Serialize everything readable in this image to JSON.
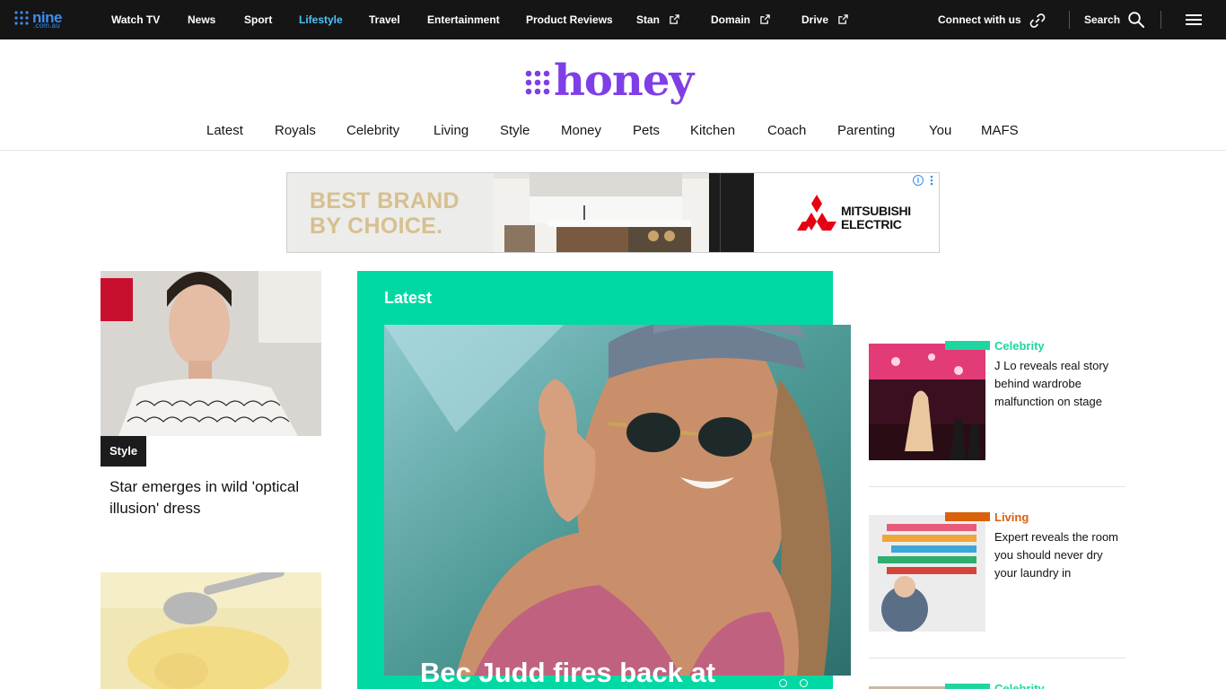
{
  "topbar": {
    "logo_word": "nine",
    "logo_sub": ".com.au",
    "nav": [
      {
        "label": "Watch TV",
        "external": false,
        "active": false
      },
      {
        "label": "News",
        "external": false,
        "active": false
      },
      {
        "label": "Sport",
        "external": false,
        "active": false
      },
      {
        "label": "Lifestyle",
        "external": false,
        "active": true
      },
      {
        "label": "Travel",
        "external": false,
        "active": false
      },
      {
        "label": "Entertainment",
        "external": false,
        "active": false
      },
      {
        "label": "Product Reviews",
        "external": false,
        "active": false
      },
      {
        "label": "Stan",
        "external": true,
        "active": false
      },
      {
        "label": "Domain",
        "external": true,
        "active": false
      },
      {
        "label": "Drive",
        "external": true,
        "active": false
      }
    ],
    "connect_label": "Connect with us",
    "search_label": "Search",
    "colors": {
      "background": "#151515",
      "active": "#4cc3f5",
      "logo": "#3b8df0"
    }
  },
  "brand": {
    "name": "honey",
    "color": "#7f3fe6"
  },
  "section_nav": [
    "Latest",
    "Royals",
    "Celebrity",
    "Living",
    "Style",
    "Money",
    "Pets",
    "Kitchen",
    "Coach",
    "Parenting",
    "You",
    "MAFS"
  ],
  "ad": {
    "headline_line1": "BEST BRAND",
    "headline_line2": "BY CHOICE.",
    "brand_line1": "MITSUBISHI",
    "brand_line2": "ELECTRIC",
    "info_icon": "info-icon",
    "more_icon": "more-vertical-icon"
  },
  "left_column": {
    "story1": {
      "tag": "Style",
      "headline": "Star emerges in wild 'optical illusion' dress"
    }
  },
  "feature": {
    "label": "Latest",
    "headline": "Bec Judd fires back at",
    "accent_color": "#00d9a3"
  },
  "side_stories": [
    {
      "category": "Celebrity",
      "title": "J Lo reveals real story behind wardrobe malfunction on stage",
      "color": "#1fd6a0"
    },
    {
      "category": "Living",
      "title": "Expert reveals the room you should never dry your laundry in",
      "color": "#d9620c"
    },
    {
      "category": "Celebrity",
      "title": "",
      "color": "#1fd6a0"
    }
  ]
}
